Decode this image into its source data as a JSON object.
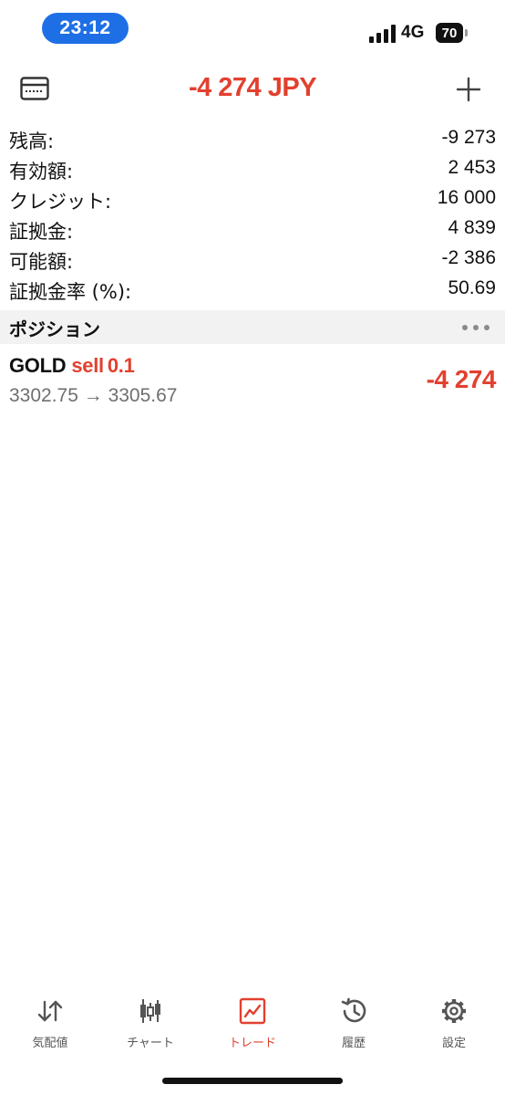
{
  "status_bar": {
    "time": "23:12",
    "network": "4G",
    "battery": "70"
  },
  "header": {
    "title": "-4 274 JPY",
    "accent_color": "#e2402f"
  },
  "summary": [
    {
      "label": "残高:",
      "value": "-9 273"
    },
    {
      "label": "有効額:",
      "value": "2 453"
    },
    {
      "label": "クレジット:",
      "value": "16 000"
    },
    {
      "label": "証拠金:",
      "value": "4 839"
    },
    {
      "label": "可能額:",
      "value": "-2 386"
    },
    {
      "label": "証拠金率 (%):",
      "value": "50.69"
    }
  ],
  "positions": {
    "title": "ポジション",
    "items": [
      {
        "symbol": "GOLD",
        "side": "sell",
        "volume": "0.1",
        "prices": "3302.75 → 3305.67",
        "profit": "-4 274"
      }
    ]
  },
  "tabs": [
    {
      "label": "気配値",
      "icon": "quotes-arrows-icon",
      "active": false
    },
    {
      "label": "チャート",
      "icon": "candlestick-icon",
      "active": false
    },
    {
      "label": "トレード",
      "icon": "trade-chart-icon",
      "active": true
    },
    {
      "label": "履歴",
      "icon": "history-clock-icon",
      "active": false
    },
    {
      "label": "設定",
      "icon": "gear-icon",
      "active": false
    }
  ]
}
